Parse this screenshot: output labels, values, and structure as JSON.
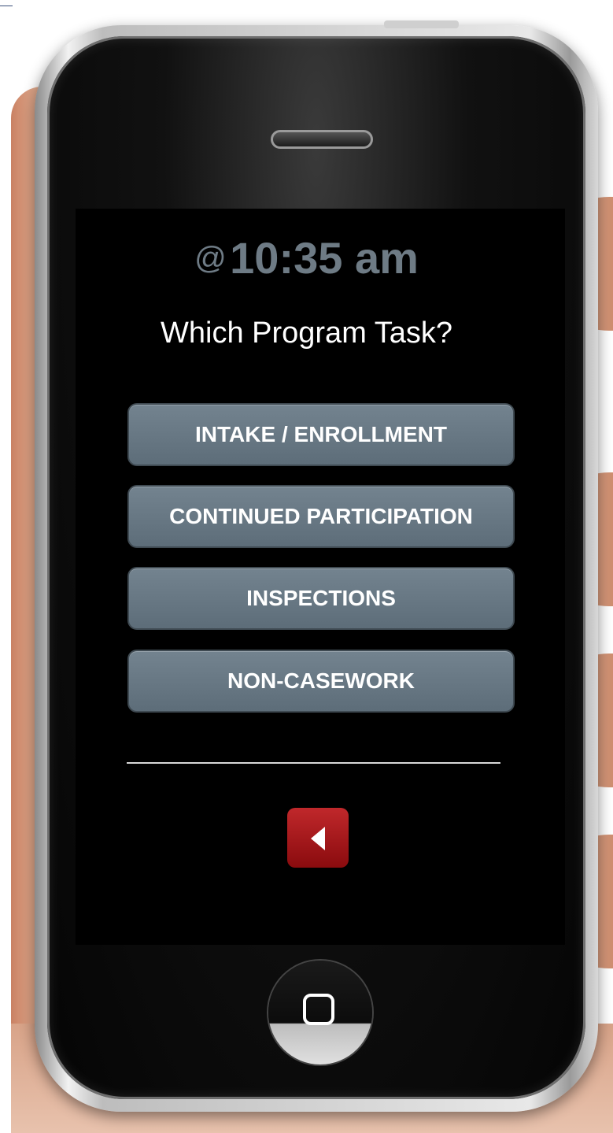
{
  "screen": {
    "time_prefix": "@",
    "time": "10:35 am",
    "prompt": "Which Program Task?"
  },
  "tasks": [
    {
      "label": "INTAKE / ENROLLMENT"
    },
    {
      "label": "CONTINUED PARTICIPATION"
    },
    {
      "label": "INSPECTIONS"
    },
    {
      "label": "NON-CASEWORK"
    }
  ],
  "icons": {
    "back": "chevron-left-icon",
    "home": "home-square-icon"
  },
  "colors": {
    "time_text": "#6e7b85",
    "button": "#5d6d79",
    "back_button": "#a8181b"
  }
}
